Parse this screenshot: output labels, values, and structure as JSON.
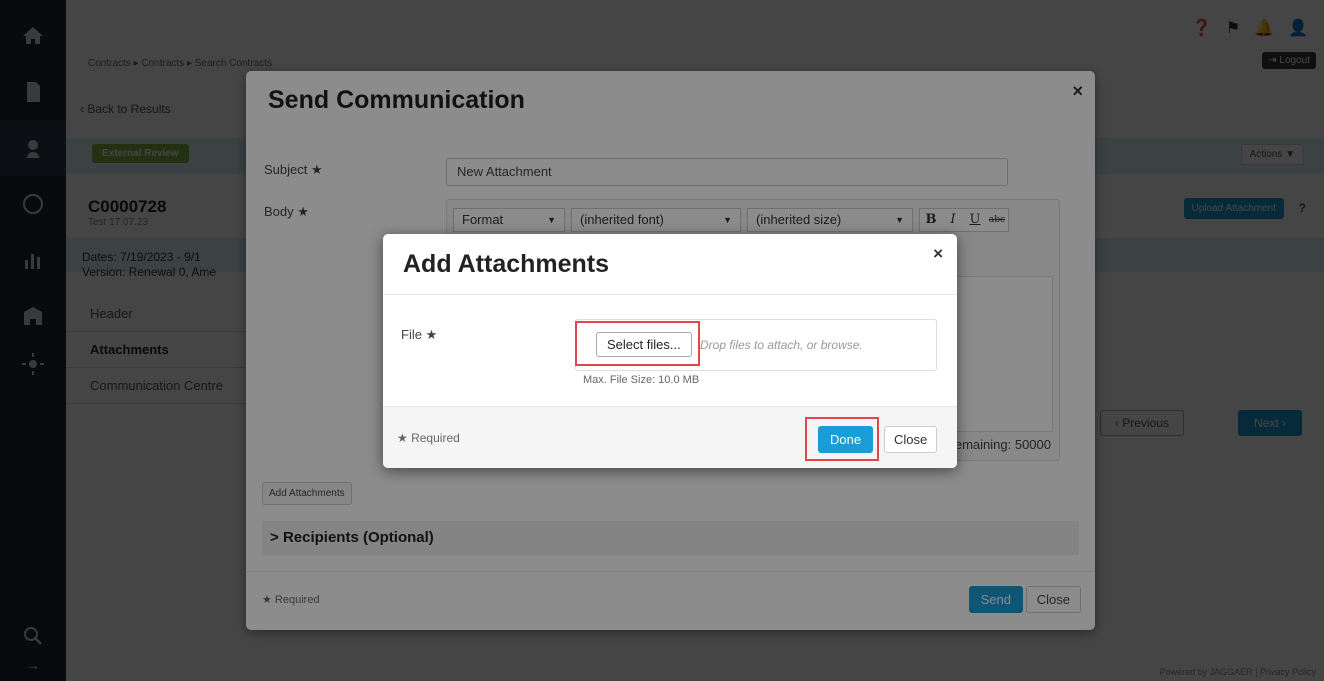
{
  "breadcrumb": [
    "Contracts ▸ Contracts ▸ Search Contracts"
  ],
  "top_icons": {
    "help": "help-icon",
    "flag": "flag-icon",
    "bell": "bell-icon",
    "user": "user-icon"
  },
  "logout_label": "Logout",
  "back_link": "‹ Back to Results",
  "status_badge": "External Review",
  "actions_label": "Actions ▼",
  "contract": {
    "id": "C0000728",
    "subtitle": "Test 17.07.23",
    "dates_line": "Dates:   7/19/2023 - 9/1",
    "version_line": "Version:   Renewal 0, Ame"
  },
  "upload_attachment_label": "Upload Attachment",
  "help_q": "?",
  "tabs": [
    {
      "label": "Header",
      "active": false
    },
    {
      "label": "Attachments",
      "active": true
    },
    {
      "label": "Communication Centre",
      "active": false
    }
  ],
  "pager": {
    "previous": "‹ Previous",
    "next": "Next ›"
  },
  "footer": "Powered by JAGGAER | Privacy Policy",
  "send_modal": {
    "title": "Send Communication",
    "close": "×",
    "subject_label": "Subject",
    "subject_value": "New Attachment",
    "body_label": "Body",
    "toolbar": {
      "format": "Format",
      "font": "(inherited font)",
      "size": "(inherited size)",
      "bold": "B",
      "italic": "I",
      "underline": "U",
      "strike": "abc"
    },
    "remaining": "emaining: 50000",
    "add_attachments_label": "Add Attachments",
    "recipients": "Recipients (Optional)",
    "required": "Required",
    "send": "Send",
    "close_btn": "Close"
  },
  "attach_modal": {
    "title": "Add Attachments",
    "close": "×",
    "file_label": "File",
    "select_files": "Select files...",
    "drop_hint": "Drop files to attach, or browse.",
    "max_size": "Max. File Size: 10.0 MB",
    "required": "Required",
    "done": "Done",
    "close_btn": "Close"
  },
  "colors": {
    "accent": "#1a9cd7",
    "highlight": "#e0474c",
    "status_green": "#7bb341",
    "nav_bg": "#1f2933"
  }
}
